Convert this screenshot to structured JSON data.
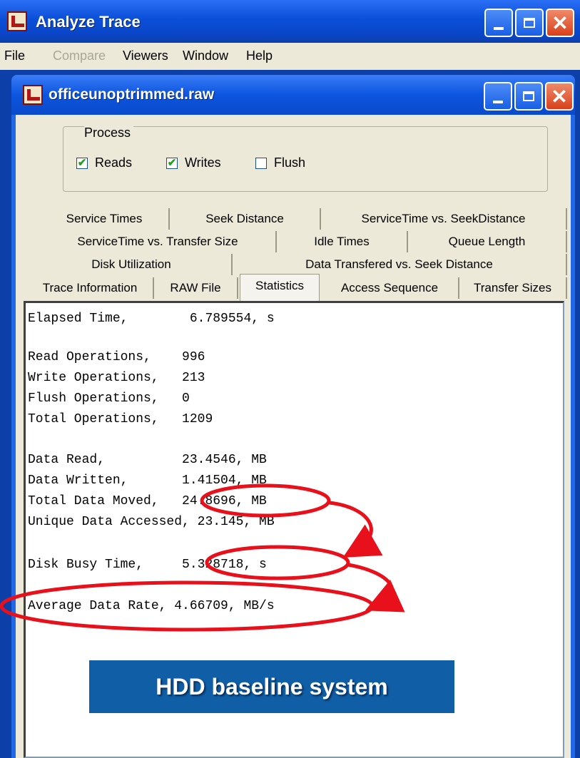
{
  "outer_window": {
    "title": "Analyze Trace",
    "menu": [
      {
        "label": "File",
        "enabled": true
      },
      {
        "label": "Compare",
        "enabled": false
      },
      {
        "label": "Viewers",
        "enabled": true
      },
      {
        "label": "Window",
        "enabled": true
      },
      {
        "label": "Help",
        "enabled": true
      }
    ]
  },
  "inner_window": {
    "title": "officeunoptrimmed.raw"
  },
  "process": {
    "legend": "Process",
    "options": [
      {
        "label": "Reads",
        "checked": true
      },
      {
        "label": "Writes",
        "checked": true
      },
      {
        "label": "Flush",
        "checked": false
      }
    ]
  },
  "tabs": {
    "row1": [
      "Service Times",
      "Seek Distance",
      "ServiceTime vs. SeekDistance"
    ],
    "row2": [
      "ServiceTime  vs. Transfer Size",
      "Idle Times",
      "Queue Length"
    ],
    "row3": [
      "Disk Utilization",
      "Data Transfered vs. Seek Distance"
    ],
    "row4": [
      "Trace Information",
      "RAW File",
      "Statistics",
      "Access Sequence",
      "Transfer Sizes"
    ],
    "active": "Statistics"
  },
  "statistics": [
    "Elapsed Time,        6.789554, s",
    "",
    "Read Operations,    996",
    "Write Operations,   213",
    "Flush Operations,   0",
    "Total Operations,   1209",
    "",
    "Data Read,          23.4546, MB",
    "Data Written,       1.41504, MB",
    "Total Data Moved,   24.8696, MB",
    "Unique Data Accessed, 23.145, MB",
    "",
    "Disk Busy Time,     5.328718, s",
    "",
    "Average Data Rate, 4.66709, MB/s"
  ],
  "annotation": {
    "label": "HDD baseline system",
    "circle_color": "#e8101a"
  },
  "colors": {
    "title_bar": "#0b4fd8",
    "window_face": "#ece9d8",
    "badge": "#0f5ea6"
  }
}
